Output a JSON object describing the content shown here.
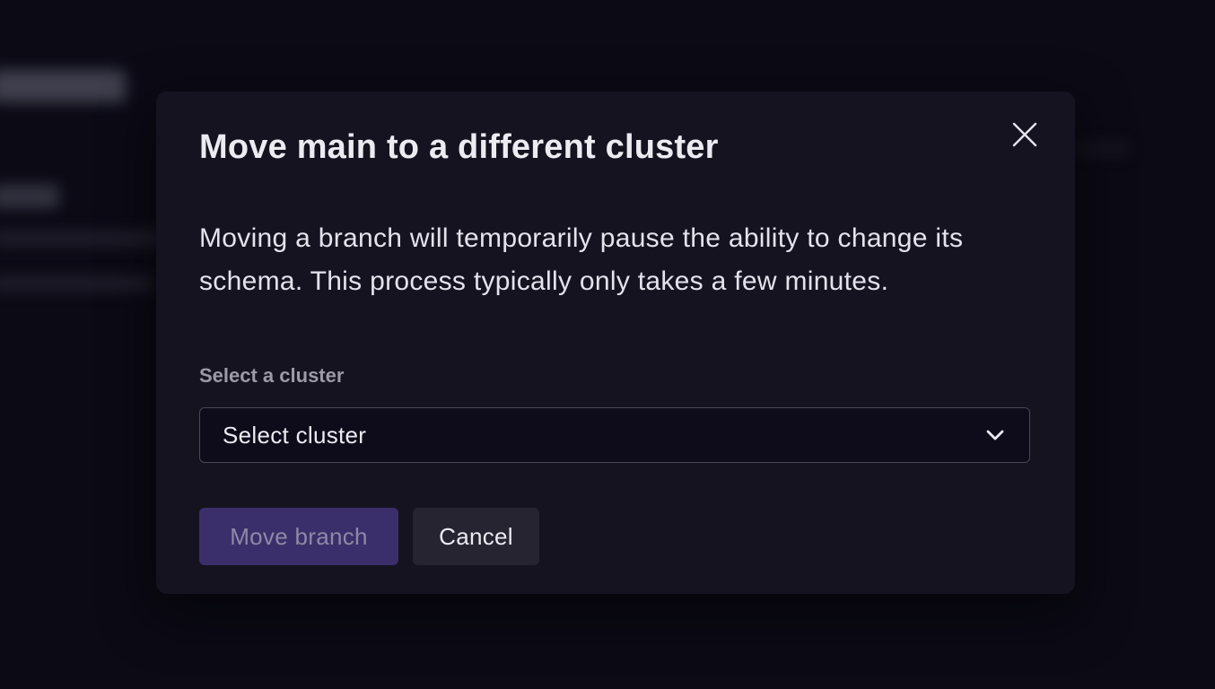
{
  "dialog": {
    "title": "Move main to a different cluster",
    "description": "Moving a branch will temporarily pause the ability to change its schema. This process typically only takes a few minutes.",
    "close_icon": "close-icon",
    "field": {
      "label": "Select a cluster",
      "value": "Select cluster",
      "icon": "chevron-down-icon"
    },
    "buttons": {
      "primary": {
        "label": "Move branch",
        "disabled": true,
        "color": "#3b2f6b"
      },
      "secondary": {
        "label": "Cancel"
      }
    }
  },
  "colors": {
    "background": "#0b0a15",
    "modal": "#15131f",
    "accent": "#3b2f6b"
  }
}
